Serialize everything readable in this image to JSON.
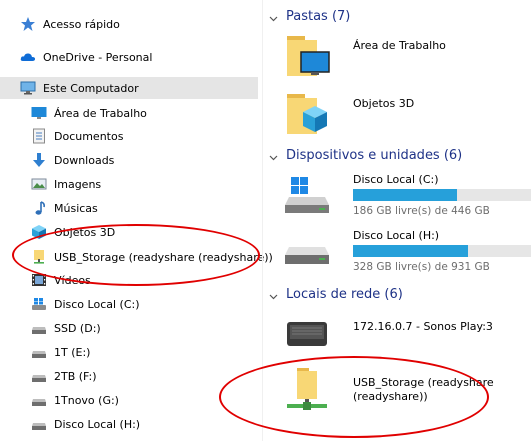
{
  "nav": {
    "quick_access": "Acesso rápido",
    "onedrive": "OneDrive - Personal",
    "this_pc": "Este Computador",
    "items": [
      "Área de Trabalho",
      "Documentos",
      "Downloads",
      "Imagens",
      "Músicas",
      "Objetos 3D",
      "USB_Storage (readyshare (readyshare))",
      "Vídeos",
      "Disco Local (C:)",
      "SSD (D:)",
      "1T (E:)",
      "2TB (F:)",
      "1Tnovo (G:)",
      "Disco Local (H:)"
    ]
  },
  "content": {
    "folders_header": "Pastas (7)",
    "folders": [
      "Área de Trabalho",
      "Objetos 3D"
    ],
    "devices_header": "Dispositivos e unidades (6)",
    "drives": [
      {
        "name": "Disco Local (C:)",
        "free": "186 GB livre(s) de 446 GB",
        "used_fraction": 0.583
      },
      {
        "name": "Disco Local (H:)",
        "free": "328 GB livre(s) de 931 GB",
        "used_fraction": 0.648
      }
    ],
    "network_header": "Locais de rede (6)",
    "network": [
      {
        "name_line1": "172.16.0.7 - Sonos Play:3",
        "name_line2": ""
      },
      {
        "name_line1": "USB_Storage (readyshare",
        "name_line2": "(readyshare))"
      }
    ]
  },
  "colors": {
    "accent_blue": "#26a0da",
    "header_blue": "#1e3287",
    "highlight_red": "#e00000",
    "selection_gray": "#e5e5e5"
  }
}
